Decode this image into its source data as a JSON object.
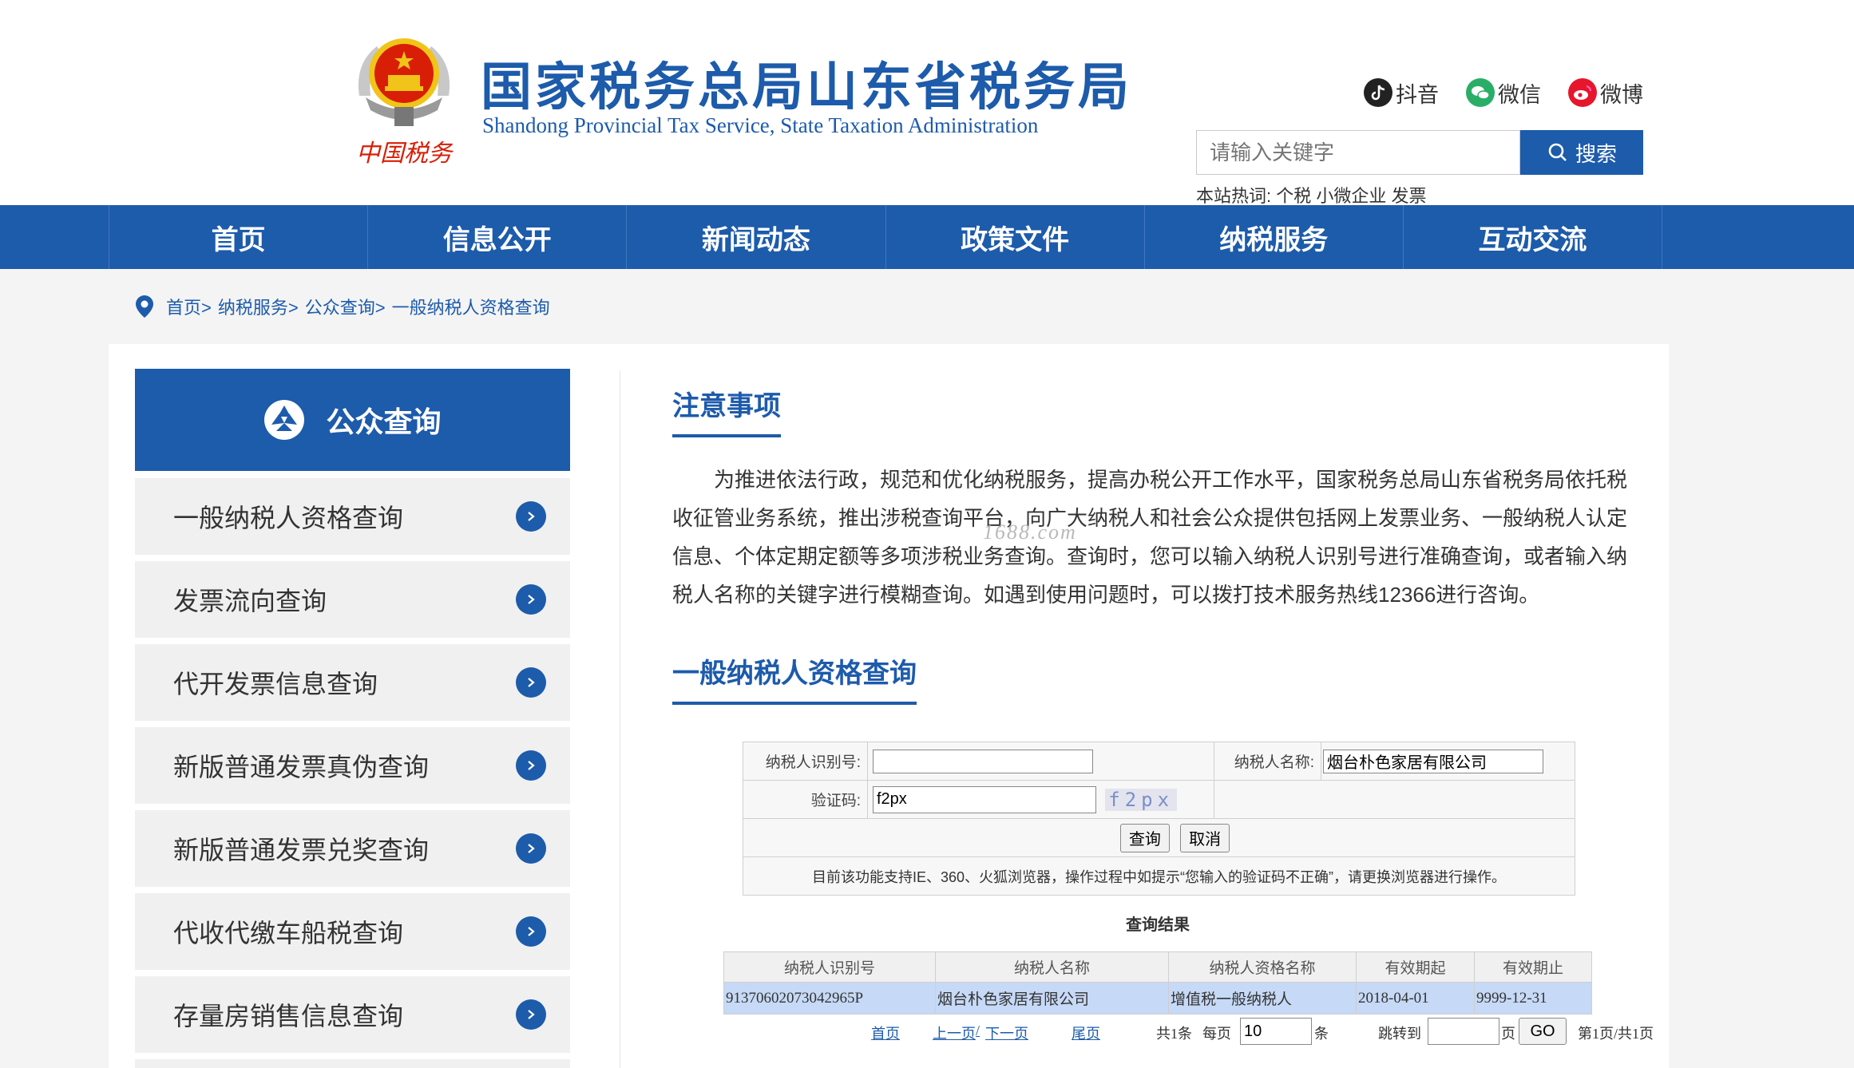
{
  "header": {
    "site_title": "国家税务总局山东省税务局",
    "site_subtitle": "Shandong Provincial Tax Service, State Taxation Administration",
    "logo_text": "中国税务",
    "social": [
      {
        "label": "抖音",
        "icon": "douyin-icon",
        "color": "#222222"
      },
      {
        "label": "微信",
        "icon": "wechat-icon",
        "color": "#2aae67"
      },
      {
        "label": "微博",
        "icon": "weibo-icon",
        "color": "#e6162d"
      }
    ],
    "search_placeholder": "请输入关键字",
    "search_button": "搜索",
    "hot_words_label": "本站热词:",
    "hot_words": "个税 小微企业 发票"
  },
  "nav": [
    "首页",
    "信息公开",
    "新闻动态",
    "政策文件",
    "纳税服务",
    "互动交流"
  ],
  "breadcrumb": [
    "首页>",
    "纳税服务>",
    "公众查询>",
    "一般纳税人资格查询"
  ],
  "sidebar": {
    "title": "公众查询",
    "items": [
      "一般纳税人资格查询",
      "发票流向查询",
      "代开发票信息查询",
      "新版普通发票真伪查询",
      "新版普通发票兑奖查询",
      "代收代缴车船税查询",
      "存量房销售信息查询"
    ]
  },
  "notice": {
    "title": "注意事项",
    "text": "为推进依法行政，规范和优化纳税服务，提高办税公开工作水平，国家税务总局山东省税务局依托税收征管业务系统，推出涉税查询平台，向广大纳税人和社会公众提供包括网上发票业务、一般纳税人认定信息、个体定期定额等多项涉税业务查询。查询时，您可以输入纳税人识别号进行准确查询，或者输入纳税人名称的关键字进行模糊查询。如遇到使用问题时，可以拨打技术服务热线12366进行咨询。",
    "watermark": "1688.com"
  },
  "query": {
    "title": "一般纳税人资格查询",
    "id_label": "纳税人识别号:",
    "id_value": "",
    "name_label": "纳税人名称:",
    "name_value": "烟台朴色家居有限公司",
    "captcha_label": "验证码:",
    "captcha_value": "f2px",
    "captcha_image_text": "f2px",
    "submit_button": "查询",
    "cancel_button": "取消",
    "hint": "目前该功能支持IE、360、火狐浏览器，操作过程中如提示“您输入的验证码不正确”，请更换浏览器进行操作。"
  },
  "results": {
    "title": "查询结果",
    "columns": [
      "纳税人识别号",
      "纳税人名称",
      "纳税人资格名称",
      "有效期起",
      "有效期止"
    ],
    "rows": [
      [
        "91370602073042965P",
        "烟台朴色家居有限公司",
        "增值税一般纳税人",
        "2018-04-01",
        "9999-12-31"
      ]
    ]
  },
  "pager": {
    "first": "首页",
    "prev": "上一页",
    "sep": "/",
    "next": "下一页",
    "last": "尾页",
    "total": "共1条",
    "per_page_label": "每页",
    "per_page_value": "10",
    "unit": "条",
    "jump_label": "跳转到",
    "jump_value": "",
    "page_unit": "页",
    "go": "GO",
    "page_info": "第1页/共1页"
  },
  "colors": {
    "brand_blue": "#1d5bab",
    "emblem_red": "#d81e06",
    "emblem_gold": "#f0c419",
    "result_row": "#c6d9f6"
  }
}
